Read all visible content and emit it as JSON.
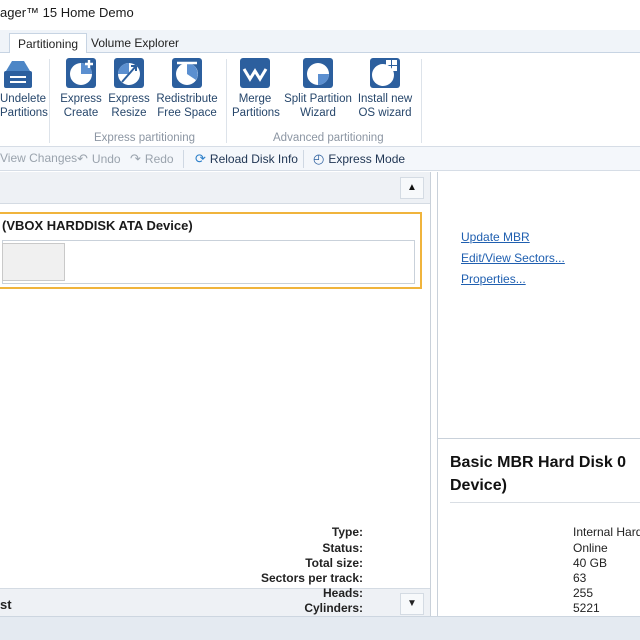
{
  "window": {
    "title": "ager™ 15 Home Demo"
  },
  "tabs": [
    {
      "label": "Partitioning",
      "active": true
    },
    {
      "label": "Volume Explorer",
      "active": false
    }
  ],
  "ribbon": {
    "buttons": [
      {
        "line1": "Undelete",
        "line2": "Partitions",
        "icon": "undelete-icon"
      },
      {
        "line1": "Express",
        "line2": "Create",
        "icon": "express-create-icon"
      },
      {
        "line1": "Express",
        "line2": "Resize",
        "icon": "express-resize-icon"
      },
      {
        "line1": "Redistribute",
        "line2": "Free Space",
        "icon": "redistribute-icon"
      },
      {
        "line1": "Merge",
        "line2": "Partitions",
        "icon": "merge-icon"
      },
      {
        "line1": "Split Partition",
        "line2": "Wizard",
        "icon": "split-icon"
      },
      {
        "line1": "Install new",
        "line2": "OS wizard",
        "icon": "install-os-icon"
      }
    ],
    "groups": {
      "express": "Express partitioning",
      "advanced": "Advanced partitioning"
    }
  },
  "toolbar": {
    "view_changes": "View Changes",
    "undo": "Undo",
    "redo": "Redo",
    "reload": "Reload Disk Info",
    "express_mode": "Express Mode"
  },
  "disk_map": {
    "title": "(VBOX HARDDISK ATA Device)"
  },
  "footer": {
    "label": "st"
  },
  "right_links": {
    "update_mbr": "Update MBR",
    "edit_sectors": "Edit/View Sectors...",
    "properties": "Properties..."
  },
  "disk_info": {
    "title_line1": "Basic MBR Hard Disk 0",
    "title_line2": "Device)",
    "props": [
      {
        "key": "Type:",
        "value": "Internal Hard D"
      },
      {
        "key": "Status:",
        "value": "Online"
      },
      {
        "key": "Total size:",
        "value": "40 GB"
      },
      {
        "key": "Sectors per track:",
        "value": "63"
      },
      {
        "key": "Heads:",
        "value": "255"
      },
      {
        "key": "Cylinders:",
        "value": "5221"
      }
    ]
  },
  "colors": {
    "accent": "#2c5f9e",
    "selection": "#f0b43c",
    "link": "#1f5fb0"
  }
}
